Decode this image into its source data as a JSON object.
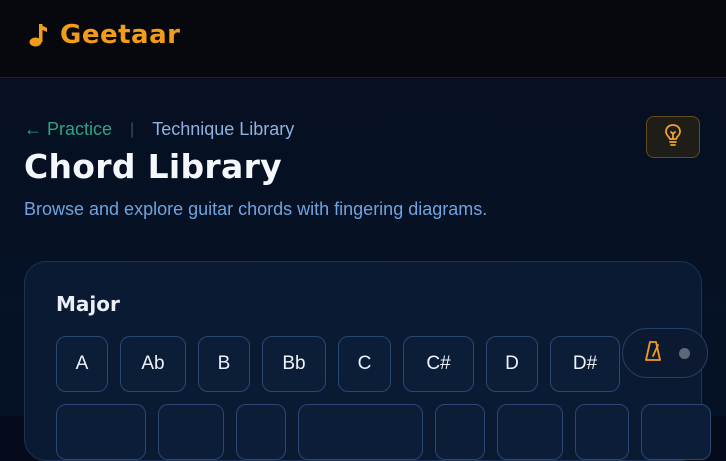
{
  "app": {
    "name": "Geetaar",
    "brand_color": "#f39c1a",
    "brand_icon": "music-note-icon"
  },
  "breadcrumb": {
    "back_label": "← Practice",
    "current_label": "Technique Library"
  },
  "header": {
    "title": "Chord Library",
    "subtitle": "Browse and explore guitar chords with fingering diagrams."
  },
  "hint_button": {
    "icon": "lightbulb-icon"
  },
  "sections": [
    {
      "title": "Major",
      "row1": [
        "A",
        "Ab",
        "B",
        "Bb",
        "C",
        "C#",
        "D",
        "D#"
      ]
    }
  ],
  "metronome": {
    "icon": "metronome-icon"
  }
}
